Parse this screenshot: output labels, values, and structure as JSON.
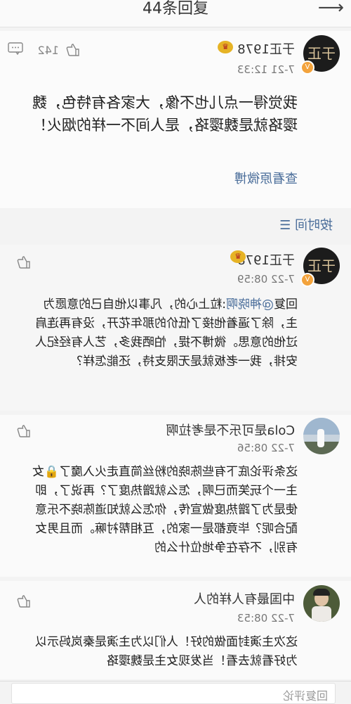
{
  "header": {
    "title": "44条回复",
    "back_icon": "arrow-left-icon"
  },
  "original": {
    "username": "于正1978",
    "time": "7-21 12:33",
    "text": "我觉得一点儿也不像，大家各有特色，魏璎珞就是魏璎珞，是人间不一样的烟火！",
    "view_source": "查看原微博",
    "likes": "142"
  },
  "sort_label": "按时间",
  "comments": [
    {
      "username": "于正1978",
      "time": "7-22 08:59",
      "reply_prefix": "回复",
      "reply_to": "@神晓啊",
      "text": ":粒上心的，凡事以他自己的意愿为主，除了逼着他接了低价的那年花开，没有再连肩过他的意思。微博不提，怕晒我多，艺人有经纪人安排，我一老板就是无限支持，还能怎样？"
    },
    {
      "username": "Cola是可乐不是考拉啊",
      "time": "7-22 08:56",
      "text": "这条评论底下有些陈晓的粉丝简直走火入魔了🔒女主一个玩笑而已啊，怎么就蹭热度了？再说了，即使是为了蹭热度做宣传，你怎么就知道陈晓不乐意配合呢？毕竟都是一家的，互相帮衬嘛。而且男女有别，不存在争地位什么的"
    },
    {
      "username": "中国最有人样的人",
      "time": "7-22 08:53",
      "text": "这次主演封面做的好！人们以为主演是秦岚妈示以为好看就去看！当发现女主是魏璎珞"
    }
  ],
  "input": {
    "placeholder": "回复评论"
  },
  "colors": {
    "link": "#4a6d9a",
    "crown": "#e6b325",
    "verified": "#f3a33c"
  }
}
